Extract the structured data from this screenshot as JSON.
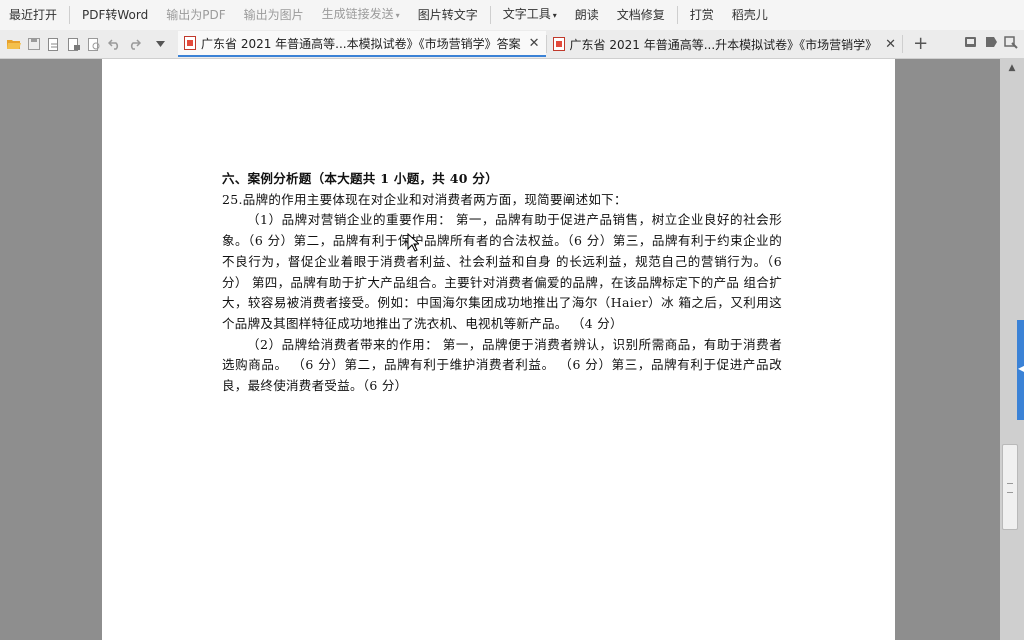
{
  "menubar": {
    "items": [
      {
        "label": "最近打开",
        "enabled": true
      },
      {
        "label": "PDF转Word",
        "enabled": true
      },
      {
        "label": "输出为PDF",
        "enabled": false
      },
      {
        "label": "输出为图片",
        "enabled": false
      },
      {
        "label": "生成链接发送",
        "enabled": false
      },
      {
        "label": "图片转文字",
        "enabled": true
      },
      {
        "label": "文字工具",
        "enabled": true
      },
      {
        "label": "朗读",
        "enabled": true
      },
      {
        "label": "文档修复",
        "enabled": true
      },
      {
        "label": "打赏",
        "enabled": true
      },
      {
        "label": "稻壳儿",
        "enabled": true
      }
    ]
  },
  "tabs": [
    {
      "title": "广东省 2021 年普通高等...本模拟试卷》《市场营销学》答案",
      "active": true
    },
    {
      "title": "广东省 2021 年普通高等...升本模拟试卷》《市场营销学》",
      "active": false
    }
  ],
  "document": {
    "heading": "六、案例分析题（本大题共 1 小题，共 40 分）",
    "q25": "25.品牌的作用主要体现在对企业和对消费者两方面，现简要阐述如下：",
    "p1": "（1）品牌对营销企业的重要作用： 第一，品牌有助于促进产品销售，树立企业良好的社会形象。（6 分）第二，品牌有利于保护品牌所有者的合法权益。（6 分）第三，品牌有利于约束企业的不良行为，督促企业着眼于消费者利益、社会利益和自身 的长远利益，规范自己的营销行为。（6 分） 第四，品牌有助于扩大产品组合。主要针对消费者偏爱的品牌，在该品牌标定下的产品 组合扩大，较容易被消费者接受。例如：中国海尔集团成功地推出了海尔（Haier）冰 箱之后，又利用这个品牌及其图样特征成功地推出了洗衣机、电视机等新产品。 （4 分）",
    "p2": "（2）品牌给消费者带来的作用： 第一，品牌便于消费者辨认，识别所需商品，有助于消费者选购商品。 （6 分）第二，品牌有利于维护消费者利益。 （6 分）第三，品牌有利于促进产品改良，最终使消费者受益。（6 分）"
  },
  "colors": {
    "accent": "#3b82d6",
    "pdf_red": "#e34a3b"
  }
}
